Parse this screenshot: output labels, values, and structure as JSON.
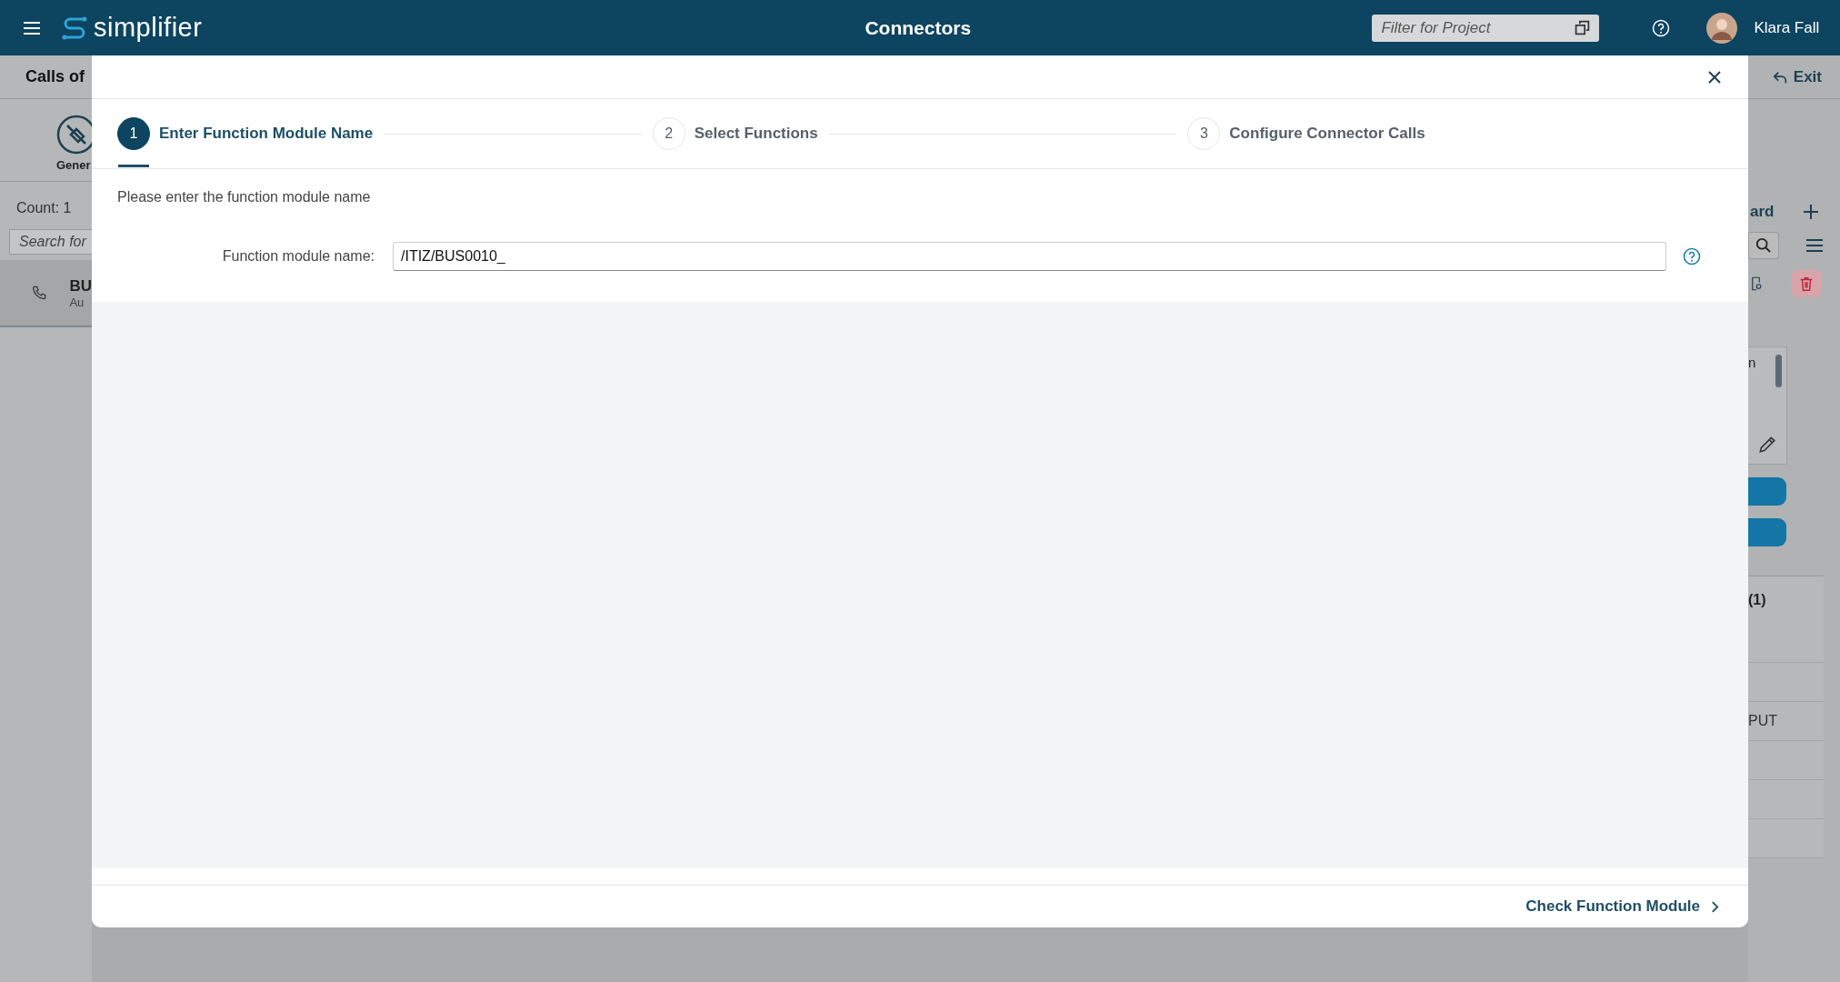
{
  "header": {
    "app_name": "simplifier",
    "title": "Connectors",
    "project_filter": {
      "placeholder": "Filter for Project"
    },
    "user": "Klara Fall"
  },
  "background_left": {
    "title": "Calls of",
    "tab_label": "Gener",
    "count": "Count: 1",
    "search": {
      "placeholder": "Search for"
    },
    "item": {
      "title": "BU",
      "subtitle": "Au"
    }
  },
  "background_right": {
    "exit": "Exit",
    "wizard": "ard",
    "panel_text": "n",
    "section": "(1)",
    "cell": "PUT"
  },
  "modal": {
    "steps": [
      {
        "number": "1",
        "label": "Enter Function Module Name",
        "selected": true
      },
      {
        "number": "2",
        "label": "Select Functions",
        "selected": false
      },
      {
        "number": "3",
        "label": "Configure Connector Calls",
        "selected": false
      }
    ],
    "instruction": "Please enter the function module name",
    "field": {
      "label": "Function module name:",
      "value": "/ITIZ/BUS0010_"
    },
    "footer_button": "Check Function Module"
  }
}
